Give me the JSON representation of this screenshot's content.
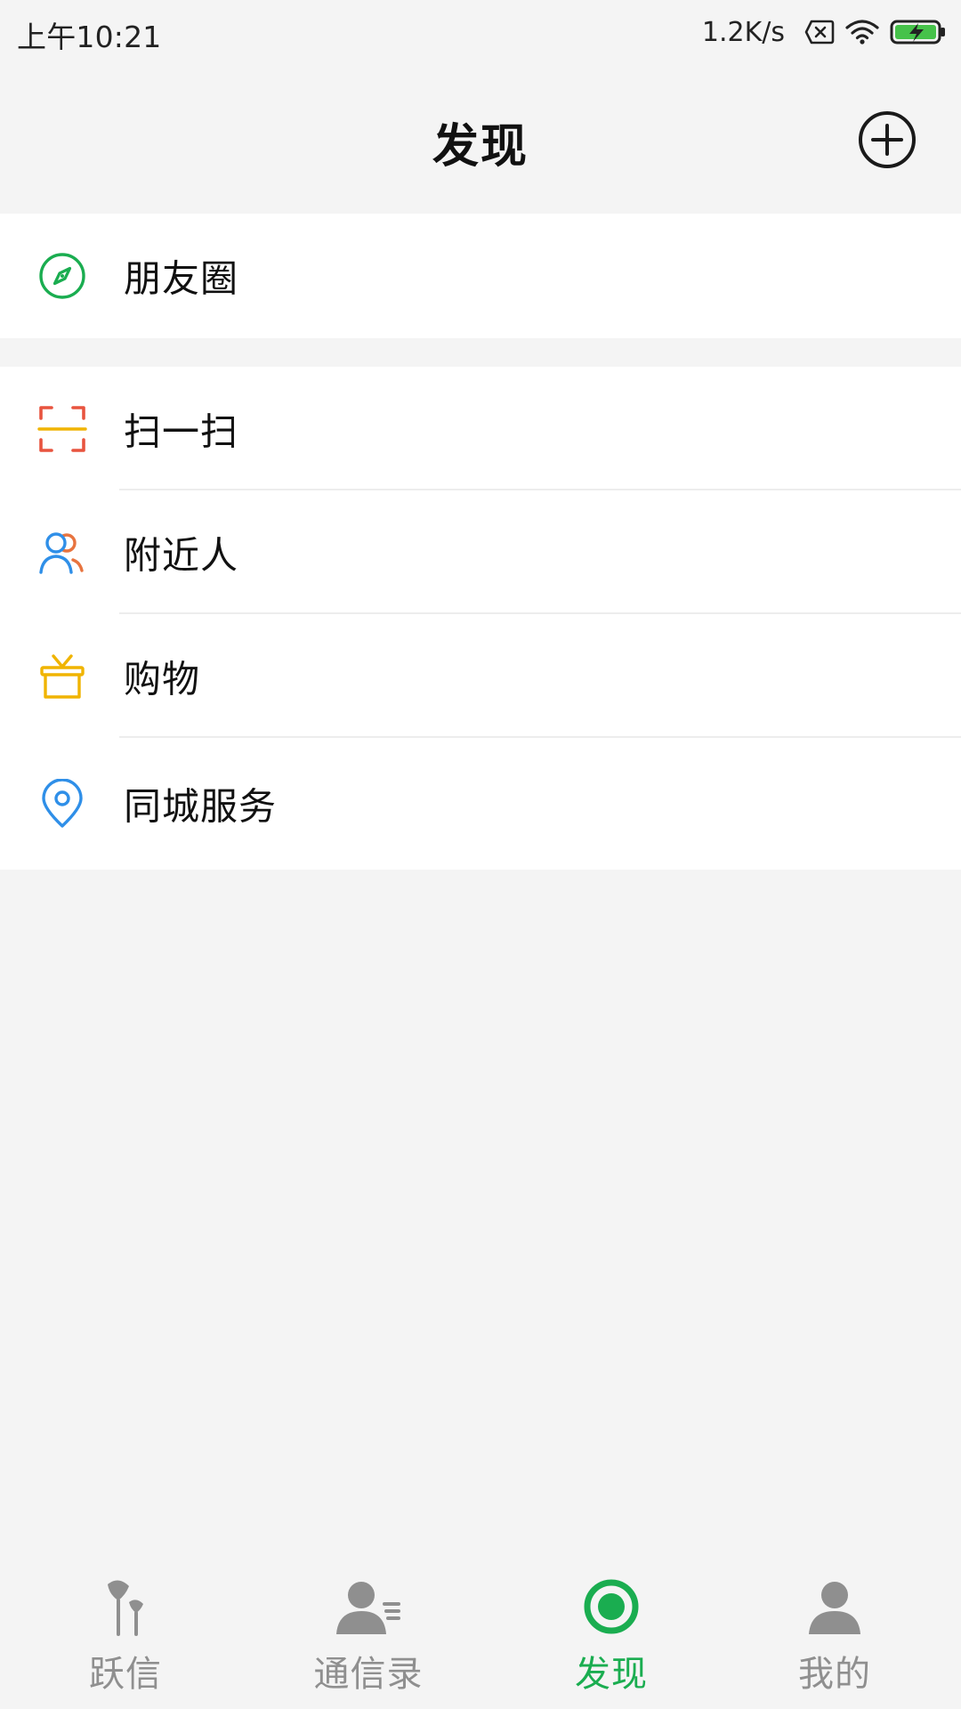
{
  "status_bar": {
    "time": "上午10:21",
    "network_speed": "1.2K/s",
    "icons": [
      "sim-error-icon",
      "wifi-icon",
      "battery-charging-icon"
    ]
  },
  "header": {
    "title": "发现",
    "add_icon": "plus-circle-icon"
  },
  "menu": {
    "group1": [
      {
        "label": "朋友圈",
        "icon": "compass-icon",
        "color": "#1aad50"
      }
    ],
    "group2": [
      {
        "label": "扫一扫",
        "icon": "scan-icon",
        "color": "#e8543f"
      },
      {
        "label": "附近人",
        "icon": "people-nearby-icon",
        "color": "#2f8fe8"
      },
      {
        "label": "购物",
        "icon": "shopping-icon",
        "color": "#f0b400"
      },
      {
        "label": "同城服务",
        "icon": "location-pin-icon",
        "color": "#2f8fe8"
      }
    ]
  },
  "tabs": [
    {
      "label": "跃信",
      "icon": "chat-app-icon",
      "active": false
    },
    {
      "label": "通信录",
      "icon": "contacts-icon",
      "active": false
    },
    {
      "label": "发现",
      "icon": "discover-icon",
      "active": true
    },
    {
      "label": "我的",
      "icon": "profile-icon",
      "active": false
    }
  ],
  "colors": {
    "active_tab": "#1aad50",
    "inactive_tab": "#8f8f8f",
    "background": "#f4f4f4"
  }
}
